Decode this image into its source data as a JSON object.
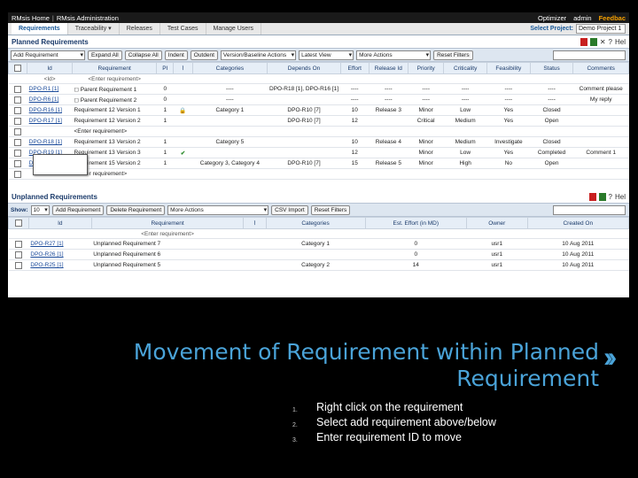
{
  "app": {
    "title": "RMsis Home",
    "admin": "RMsis Administration",
    "optimizer": "Optimizer",
    "user": "admin",
    "feedback": "Feedbac"
  },
  "tabs": [
    "Requirements",
    "Traceability ▾",
    "Releases",
    "Test Cases",
    "Manage Users"
  ],
  "project": {
    "label": "Select Project:",
    "value": "Demo Project 1"
  },
  "planned": {
    "title": "Planned Requirements",
    "help": "Hel",
    "toolbar": {
      "add": "Add Requirement",
      "expand": "Expand All",
      "collapse": "Collapse All",
      "indent": "Indent",
      "outdent": "Outdent",
      "version": "Version/Baseline Actions",
      "view": "Latest View",
      "more": "More Actions",
      "reset": "Reset Filters"
    },
    "columns": [
      "",
      "Id",
      "Requirement",
      "PI",
      "",
      "Categories",
      "Depends On",
      "Effort",
      "Release Id",
      "Priority",
      "Criticality",
      "Feasibility",
      "Status",
      "Comments"
    ],
    "filter": [
      "",
      "<Id>",
      "<Enter requirement>",
      "",
      "",
      "",
      "",
      "",
      "",
      "",
      "",
      "",
      "",
      ""
    ],
    "rows": [
      [
        "",
        "DPO-R1 [1]",
        "◻ Parent Requirement 1",
        "0",
        "",
        "----",
        "DPO-R18 [1], DPO-R16 [1]",
        "----",
        "----",
        "----",
        "----",
        "----",
        "----",
        "Comment please"
      ],
      [
        "",
        "DPO-R6 [1]",
        "◻ Parent Requirement 2",
        "0",
        "",
        "----",
        "",
        "----",
        "----",
        "----",
        "----",
        "----",
        "----",
        "My reply"
      ],
      [
        "",
        "DPO-R16 [1]",
        "Requirement 12 Version 1",
        "1",
        "lock",
        "Category 1",
        "DPO-R10 [7]",
        "10",
        "Release 3",
        "Minor",
        "Low",
        "Yes",
        "Closed",
        ""
      ],
      [
        "",
        "DPO-R17 [1]",
        "Requirement 12 Version 2",
        "1",
        "",
        "",
        "DPO-R10 [7]",
        "12",
        "",
        "Critical",
        "Medium",
        "Yes",
        "Open",
        ""
      ],
      [
        "",
        "",
        "<Enter requirement>",
        "",
        "",
        "",
        "",
        "",
        "",
        "",
        "",
        "",
        "",
        ""
      ],
      [
        "",
        "DPO-R18 [1]",
        "Requirement 13 Version 2",
        "1",
        "",
        "Category 5",
        "",
        "10",
        "Release 4",
        "Minor",
        "Medium",
        "Investigate",
        "Closed",
        ""
      ],
      [
        "",
        "DPO-R19 [1]",
        "Requirement 13 Version 3",
        "1",
        "check",
        "",
        "",
        "12",
        "",
        "Minor",
        "Low",
        "Yes",
        "Completed",
        "Comment 1"
      ],
      [
        "",
        "DPO-R20 [1]",
        "Requirement 15 Version 2",
        "1",
        "",
        "Category 3, Category 4",
        "DPO-R10 [7]",
        "15",
        "Release 5",
        "Minor",
        "High",
        "No",
        "Open",
        ""
      ],
      [
        "",
        "",
        "<Enter requirement>",
        "",
        "",
        "",
        "",
        "",
        "",
        "",
        "",
        "",
        "",
        ""
      ]
    ]
  },
  "unplanned": {
    "title": "Unplanned Requirements",
    "help": "Hel",
    "toolbar": {
      "show": "Show:",
      "count": "10",
      "add": "Add Requirement",
      "delete": "Delete Requirement",
      "more": "More Actions",
      "export": "CSV Import",
      "reset": "Reset Filters"
    },
    "columns": [
      "",
      "Id",
      "Requirement",
      "",
      "Categories",
      "Est. Effort (in MD)",
      "Owner",
      "Created On"
    ],
    "filter": [
      "",
      "",
      "<Enter requirement>",
      "",
      "",
      "",
      "",
      ""
    ],
    "rows": [
      [
        "",
        "DPO-R27 [1]",
        "Unplanned Requirement 7",
        "",
        "Category 1",
        "0",
        "usr1",
        "10 Aug 2011"
      ],
      [
        "",
        "DPO-R26 [1]",
        "Unplanned Requirement 6",
        "",
        "",
        "0",
        "usr1",
        "10 Aug 2011"
      ],
      [
        "",
        "DPO-R25 [1]",
        "Unplanned Requirement 5",
        "",
        "Category 2",
        "14",
        "usr1",
        "10 Aug 2011"
      ]
    ]
  },
  "caption": {
    "line1": "Movement of Requirement within Planned",
    "line2": "Requirement"
  },
  "steps": [
    {
      "num": "1.",
      "text": "Right click on the requirement"
    },
    {
      "num": "2.",
      "text": "Select add requirement above/below"
    },
    {
      "num": "3.",
      "text": "Enter requirement ID to move"
    }
  ]
}
